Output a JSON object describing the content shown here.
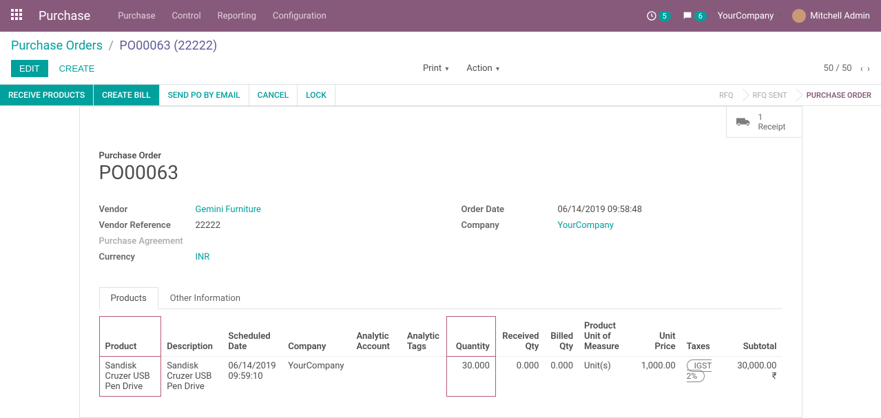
{
  "navbar": {
    "brand": "Purchase",
    "menu": [
      "Purchase",
      "Control",
      "Reporting",
      "Configuration"
    ],
    "badge1": "5",
    "badge2": "6",
    "company": "YourCompany",
    "user": "Mitchell Admin"
  },
  "breadcrumb": {
    "root": "Purchase Orders",
    "current": "PO00063 (22222)"
  },
  "cp": {
    "edit": "EDIT",
    "create": "CREATE",
    "print": "Print",
    "action": "Action",
    "pager": "50 / 50"
  },
  "actionbar": {
    "receive": "RECEIVE PRODUCTS",
    "createbill": "CREATE BILL",
    "sendpo": "SEND PO BY EMAIL",
    "cancel": "CANCEL",
    "lock": "LOCK",
    "steps": [
      "RFQ",
      "RFQ SENT",
      "PURCHASE ORDER"
    ]
  },
  "stat": {
    "count": "1",
    "label": "Receipt"
  },
  "po": {
    "label": "Purchase Order",
    "number": "PO00063",
    "fields_left": {
      "vendor_label": "Vendor",
      "vendor": "Gemini Furniture",
      "ref_label": "Vendor Reference",
      "ref": "22222",
      "agreement_label": "Purchase Agreement",
      "currency_label": "Currency",
      "currency": "INR"
    },
    "fields_right": {
      "orderdate_label": "Order Date",
      "orderdate": "06/14/2019 09:58:48",
      "company_label": "Company",
      "company": "YourCompany"
    }
  },
  "tabs": {
    "products": "Products",
    "other": "Other Information"
  },
  "table": {
    "headers": {
      "product": "Product",
      "description": "Description",
      "scheduled": "Scheduled Date",
      "company": "Company",
      "analytic_acc": "Analytic Account",
      "analytic_tags": "Analytic Tags",
      "quantity": "Quantity",
      "received": "Received Qty",
      "billed": "Billed Qty",
      "uom": "Product Unit of Measure",
      "unitprice": "Unit Price",
      "taxes": "Taxes",
      "subtotal": "Subtotal"
    },
    "row": {
      "product": "Sandisk Cruzer USB Pen Drive",
      "description": "Sandisk Cruzer USB Pen Drive",
      "scheduled": "06/14/2019 09:59:10",
      "company": "YourCompany",
      "quantity": "30.000",
      "received": "0.000",
      "billed": "0.000",
      "uom": "Unit(s)",
      "unitprice": "1,000.00",
      "tax": "IGST 2%",
      "subtotal": "30,000.00 ₹"
    }
  }
}
